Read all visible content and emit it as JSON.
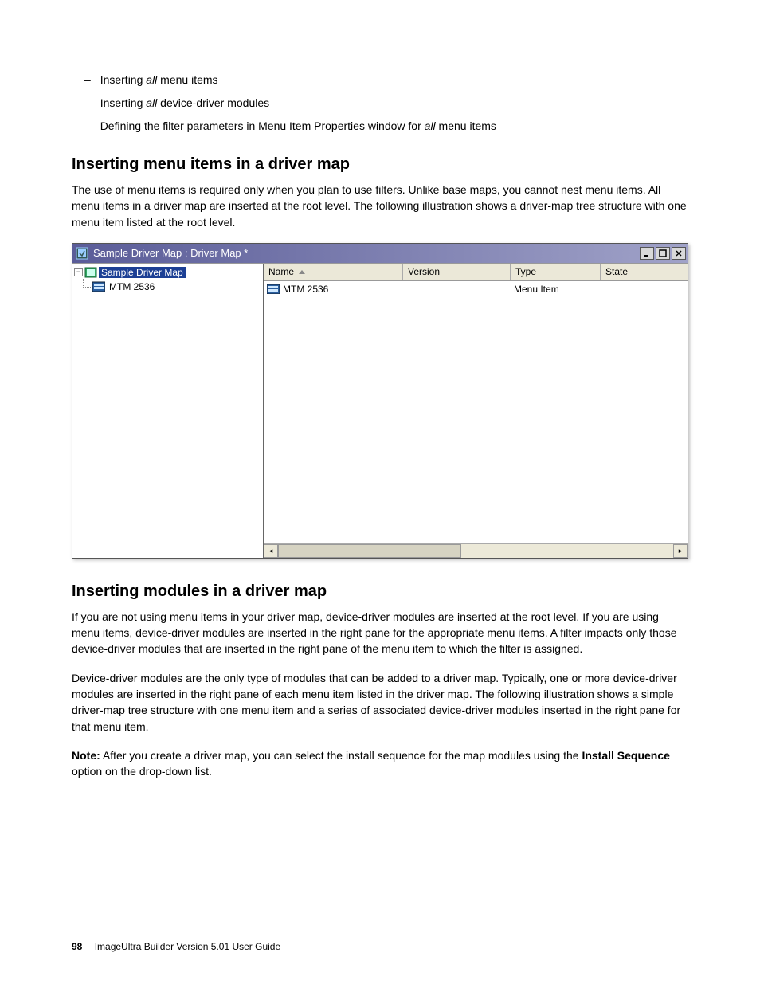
{
  "bullets": {
    "b1_pre": "Inserting ",
    "b1_em": "all",
    "b1_post": " menu items",
    "b2_pre": "Inserting ",
    "b2_em": "all",
    "b2_post": " device-driver modules",
    "b3_pre": "Defining the filter parameters in Menu Item Properties window for ",
    "b3_em": "all",
    "b3_post": " menu items"
  },
  "section1": {
    "heading": "Inserting menu items in a driver map",
    "para": "The use of menu items is required only when you plan to use filters. Unlike base maps, you cannot nest menu items. All menu items in a driver map are inserted at the root level. The following illustration shows a driver-map tree structure with one menu item listed at the root level."
  },
  "window": {
    "title": "Sample Driver Map : Driver Map *",
    "tree": {
      "root_label": "Sample Driver Map",
      "child_label": "MTM 2536",
      "toggle_symbol": "−"
    },
    "columns": {
      "name": "Name",
      "version": "Version",
      "type": "Type",
      "state": "State"
    },
    "row": {
      "name": "MTM 2536",
      "version": "",
      "type": "Menu Item",
      "state": ""
    },
    "scroll": {
      "left": "◂",
      "right": "▸"
    }
  },
  "section2": {
    "heading": "Inserting modules in a driver map",
    "para1": "If you are not using menu items in your driver map, device-driver modules are inserted at the root level. If you are using menu items, device-driver modules are inserted in the right pane for the appropriate menu items. A filter impacts only those device-driver modules that are inserted in the right pane of the menu item to which the filter is assigned.",
    "para2": "Device-driver modules are the only type of modules that can be added to a driver map. Typically, one or more device-driver modules are inserted in the right pane of each menu item listed in the driver map. The following illustration shows a simple driver-map tree structure with one menu item and a series of associated device-driver modules inserted in the right pane for that menu item.",
    "note_label": "Note:",
    "note_text_1": " After you create a driver map, you can select the install sequence for the map modules using the ",
    "note_strong": "Install Sequence",
    "note_text_2": " option on the drop-down list."
  },
  "footer": {
    "page": "98",
    "doc": "ImageUltra Builder Version 5.01 User Guide"
  }
}
